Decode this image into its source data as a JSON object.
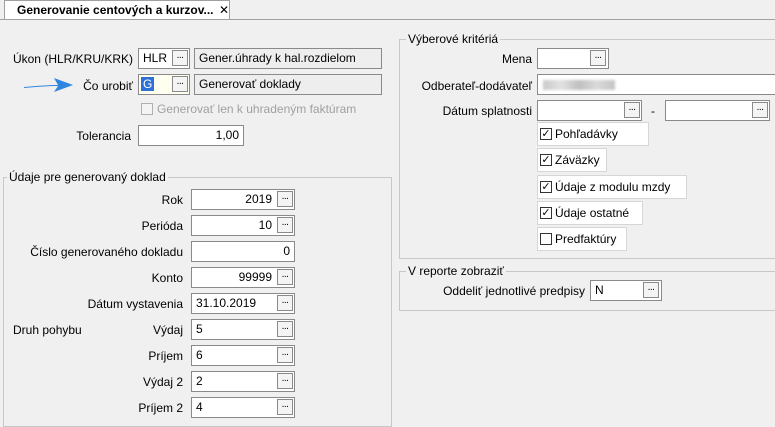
{
  "tab": {
    "title": "Generovanie centových a kurzov...",
    "close": "✕"
  },
  "form": {
    "ukon": {
      "label": "Úkon (HLR/KRU/KRK)",
      "value": "HLR",
      "description": "Gener.úhrady k hal.rozdielom"
    },
    "co_urobit": {
      "label": "Čo urobiť",
      "value": "G",
      "description": "Generovať doklady"
    },
    "generovat_len": {
      "label": "Generovať len k uhradeným faktúram",
      "checked": false
    },
    "tolerancia": {
      "label": "Tolerancia",
      "value": "1,00"
    }
  },
  "doklad": {
    "title": "Údaje pre generovaný doklad",
    "rok": {
      "label": "Rok",
      "value": "2019"
    },
    "perioda": {
      "label": "Perióda",
      "value": "10"
    },
    "cislo": {
      "label": "Číslo generovaného dokladu",
      "value": "0"
    },
    "konto": {
      "label": "Konto",
      "value": "99999"
    },
    "datum": {
      "label": "Dátum vystavenia",
      "value": "31.10.2019"
    },
    "druh_pohybu": {
      "label": "Druh pohybu"
    },
    "vydaj": {
      "label": "Výdaj",
      "value": "5"
    },
    "prijem": {
      "label": "Príjem",
      "value": "6"
    },
    "vydaj2": {
      "label": "Výdaj 2",
      "value": "2"
    },
    "prijem2": {
      "label": "Príjem 2",
      "value": "4"
    }
  },
  "kriteria": {
    "title": "Výberové kritériá",
    "mena": {
      "label": "Mena",
      "value": ""
    },
    "odberatel": {
      "label": "Odberateľ-dodávateľ"
    },
    "splatnost": {
      "label": "Dátum splatnosti",
      "separator": "-"
    },
    "pohladavky": {
      "label": "Pohľadávky",
      "checked": true
    },
    "zavazky": {
      "label": "Záväzky",
      "checked": true
    },
    "mzdy": {
      "label": "Údaje z modulu mzdy",
      "checked": true
    },
    "ostatne": {
      "label": "Údaje ostatné",
      "checked": true
    },
    "predfaktury": {
      "label": "Predfaktúry",
      "checked": false
    }
  },
  "report": {
    "title": "V reporte zobraziť",
    "oddelit": {
      "label": "Oddeliť jednotlivé predpisy",
      "value": "N"
    }
  },
  "ui": {
    "ellipsis": "...",
    "check": "✓",
    "arrow_color": "#2f86e0"
  }
}
